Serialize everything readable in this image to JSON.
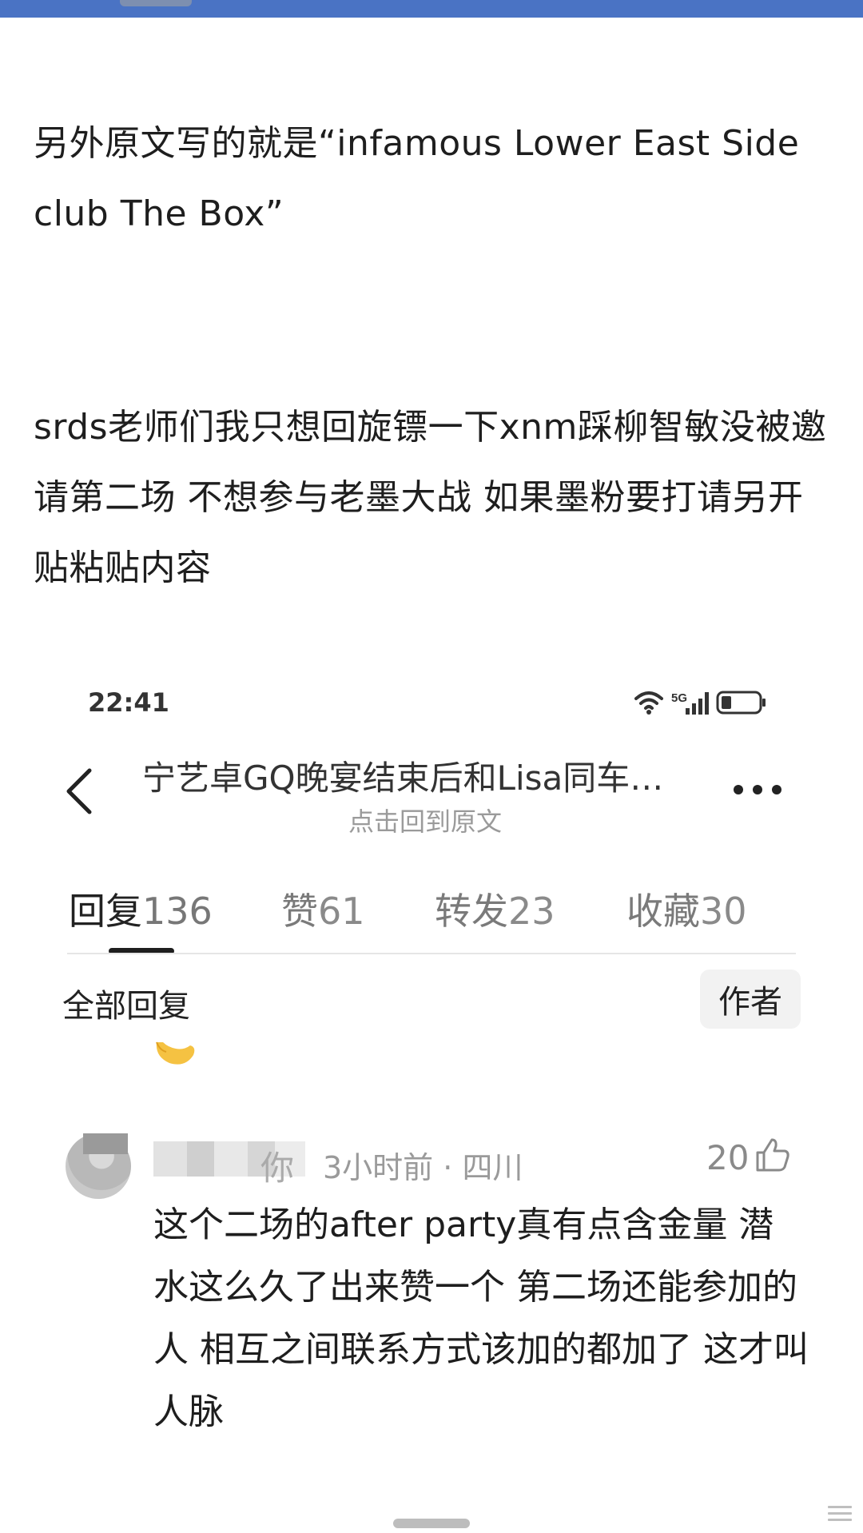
{
  "post": {
    "paragraph1": "另外原文写的就是“infamous Lower East Side club The Box”",
    "paragraph2": "srds老师们我只想回旋镖一下xnm踩柳智敏没被邀请第二场 不想参与老墨大战 如果墨粉要打请另开贴粘贴内容"
  },
  "embedded_screenshot": {
    "status_bar": {
      "time": "22:41",
      "network_label": "5G"
    },
    "nav": {
      "title": "宁艺卓GQ晚宴结束后和Lisa同车…",
      "subtitle": "点击回到原文"
    },
    "tabs": [
      {
        "label": "回复",
        "count": "136",
        "active": true
      },
      {
        "label": "赞",
        "count": "61",
        "active": false
      },
      {
        "label": "转发",
        "count": "23",
        "active": false
      },
      {
        "label": "收藏",
        "count": "30",
        "active": false
      }
    ],
    "filter": {
      "all_replies": "全部回复",
      "author_only": "作者"
    },
    "comment": {
      "username_tail": "你",
      "time": "3小时前",
      "location": "四川",
      "likes": "20",
      "text": "这个二场的after party真有点含金量 潜水这么久了出来赞一个 第二场还能参加的人 相互之间联系方式该加的都加了 这才叫人脉"
    },
    "colors": {
      "accent_bar": "#4a73c4",
      "tab_indicator": "#1e1e1e",
      "muted_text": "#9a9a9a"
    }
  }
}
